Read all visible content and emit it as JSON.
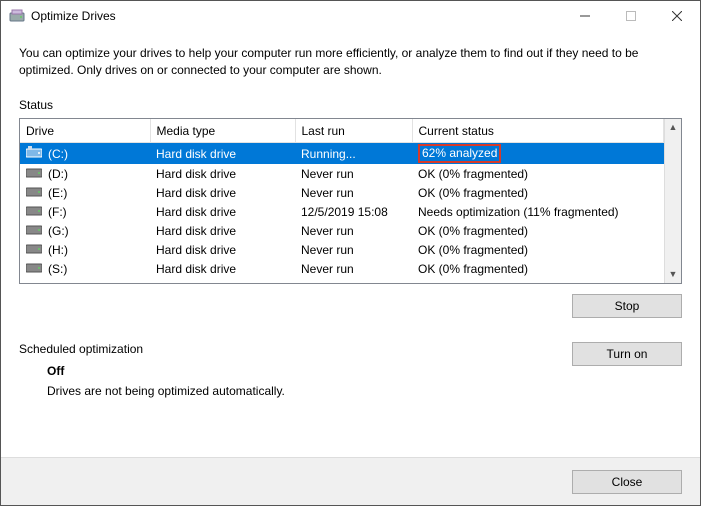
{
  "window": {
    "title": "Optimize Drives"
  },
  "intro": "You can optimize your drives to help your computer run more efficiently, or analyze them to find out if they need to be optimized. Only drives on or connected to your computer are shown.",
  "status_label": "Status",
  "table": {
    "headers": {
      "drive": "Drive",
      "media": "Media type",
      "last": "Last run",
      "status": "Current status"
    },
    "rows": [
      {
        "drive": "(C:)",
        "media": "Hard disk drive",
        "last": "Running...",
        "status": "62% analyzed",
        "selected": true,
        "highlight": true,
        "icon": "selected"
      },
      {
        "drive": "(D:)",
        "media": "Hard disk drive",
        "last": "Never run",
        "status": "OK (0% fragmented)"
      },
      {
        "drive": "(E:)",
        "media": "Hard disk drive",
        "last": "Never run",
        "status": "OK (0% fragmented)"
      },
      {
        "drive": "(F:)",
        "media": "Hard disk drive",
        "last": "12/5/2019 15:08",
        "status": "Needs optimization (11% fragmented)"
      },
      {
        "drive": "(G:)",
        "media": "Hard disk drive",
        "last": "Never run",
        "status": "OK (0% fragmented)"
      },
      {
        "drive": "(H:)",
        "media": "Hard disk drive",
        "last": "Never run",
        "status": "OK (0% fragmented)"
      },
      {
        "drive": "(S:)",
        "media": "Hard disk drive",
        "last": "Never run",
        "status": "OK (0% fragmented)"
      }
    ]
  },
  "buttons": {
    "stop": "Stop",
    "turn_on": "Turn on",
    "close": "Close"
  },
  "sched": {
    "title": "Scheduled optimization",
    "off": "Off",
    "desc": "Drives are not being optimized automatically."
  }
}
